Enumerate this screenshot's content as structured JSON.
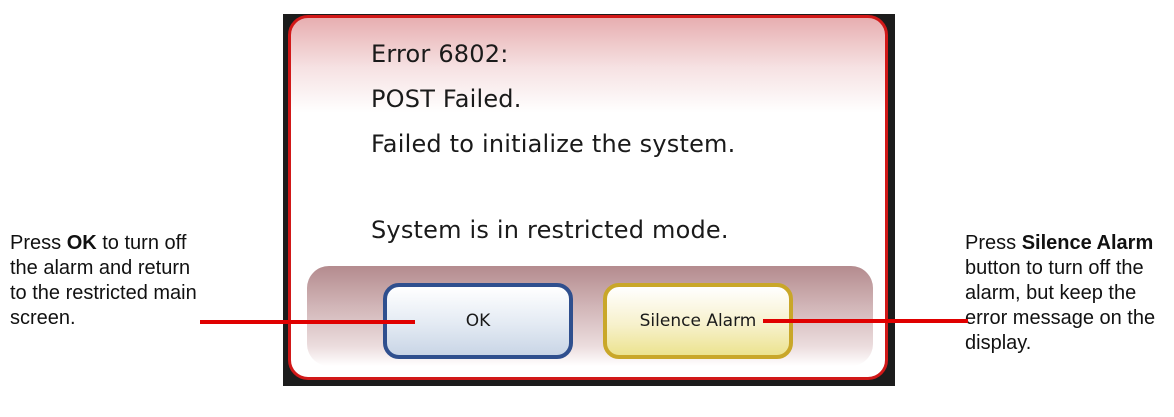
{
  "dialog": {
    "message_lines": [
      "Error 6802:",
      "POST Failed.",
      "Failed to initialize the system.",
      "System is in restricted mode."
    ],
    "ok_label": "OK",
    "silence_label": "Silence Alarm"
  },
  "callouts": {
    "left": {
      "pre": "Press ",
      "bold": "OK",
      "post": " to turn off the alarm and return to the restricted main screen."
    },
    "right": {
      "pre": "Press ",
      "bold": "Silence Alarm",
      "post": " button to turn off the alarm, but keep the error message on the display."
    }
  },
  "colors": {
    "dialog_border": "#d11818",
    "leader_line": "#e00000",
    "ok_border": "#2f4f8e",
    "silence_border": "#c9a729"
  }
}
